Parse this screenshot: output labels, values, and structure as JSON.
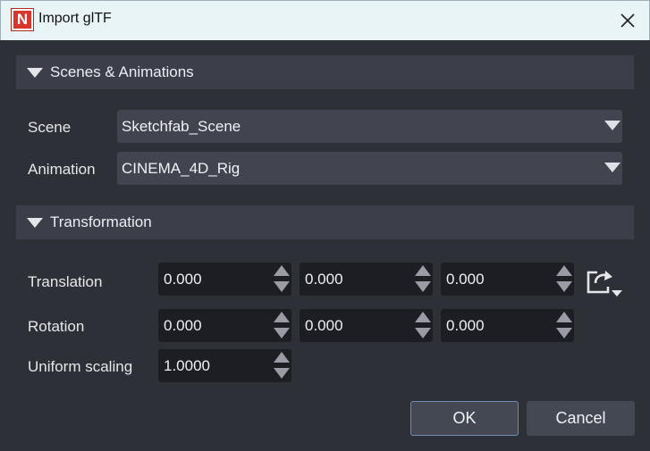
{
  "window": {
    "title": "Import glTF",
    "logo_letter": "N"
  },
  "scenes_section": {
    "header": "Scenes & Animations",
    "scene_label": "Scene",
    "scene_value": "Sketchfab_Scene",
    "animation_label": "Animation",
    "animation_value": "CINEMA_4D_Rig"
  },
  "transform_section": {
    "header": "Transformation",
    "translation_label": "Translation",
    "translation": [
      "0.000",
      "0.000",
      "0.000"
    ],
    "rotation_label": "Rotation",
    "rotation": [
      "0.000",
      "0.000",
      "0.000"
    ],
    "scaling_label": "Uniform scaling",
    "scaling": "1.0000"
  },
  "buttons": {
    "ok": "OK",
    "cancel": "Cancel"
  },
  "colors": {
    "accent_border": "#6f8bb0",
    "logo": "#d9352a",
    "background": "#2e3038"
  }
}
